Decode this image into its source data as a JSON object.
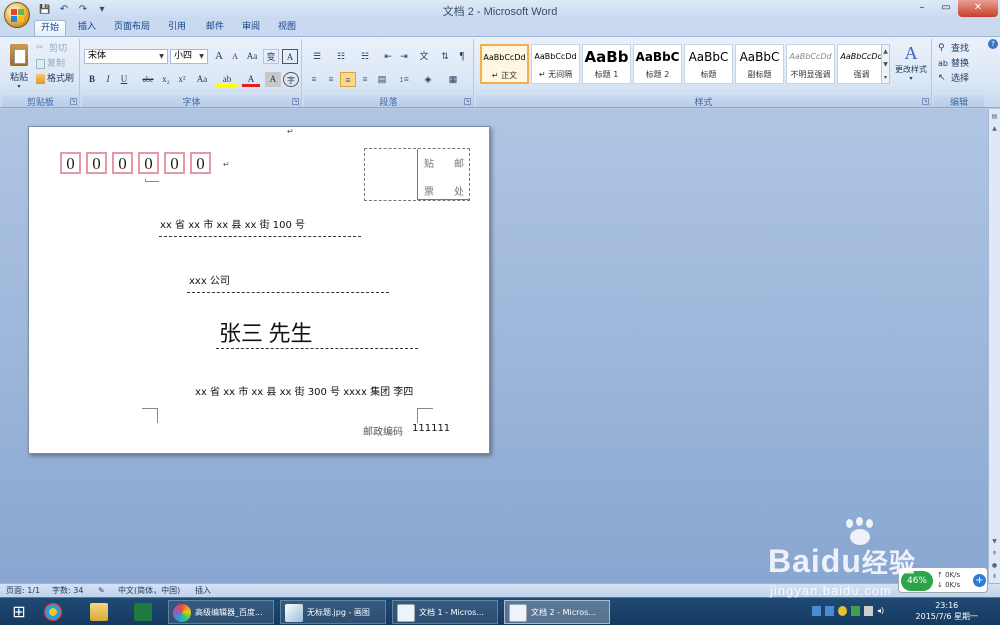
{
  "window": {
    "title": "文档 2 - Microsoft Word",
    "controls": {
      "minimize": "–",
      "maximize": "▭",
      "close": "✕"
    }
  },
  "qat": {
    "save": "💾",
    "undo": "↶",
    "redo": "↷",
    "more": "▾"
  },
  "tabs": [
    {
      "label": "开始",
      "active": true
    },
    {
      "label": "插入"
    },
    {
      "label": "页面布局"
    },
    {
      "label": "引用"
    },
    {
      "label": "邮件"
    },
    {
      "label": "审阅"
    },
    {
      "label": "视图"
    }
  ],
  "ribbon": {
    "clipboard": {
      "group_label": "剪贴板",
      "paste": "粘贴",
      "cut": "剪切",
      "copy": "复制",
      "format_painter": "格式刷"
    },
    "font": {
      "group_label": "字体",
      "font_name": "宋体",
      "font_size": "小四",
      "grow": "A",
      "shrink": "A",
      "clear": "Aa",
      "phonetic": "变",
      "border_char": "A",
      "bold": "B",
      "italic": "I",
      "underline": "U",
      "strike": "abe",
      "subscript": "x₂",
      "superscript": "x²",
      "change_case": "Aa",
      "highlight": "ab",
      "font_color": "A",
      "shade": "A",
      "enclose": "字"
    },
    "paragraph": {
      "group_label": "段落"
    },
    "styles": {
      "group_label": "样式",
      "items": [
        {
          "sample": "AaBbCcDd",
          "name": "↵ 正文",
          "selected": true
        },
        {
          "sample": "AaBbCcDd",
          "name": "↵ 无间隔"
        },
        {
          "sample": "AaBb",
          "name": "标题 1"
        },
        {
          "sample": "AaBbC",
          "name": "标题 2"
        },
        {
          "sample": "AaBbC",
          "name": "标题"
        },
        {
          "sample": "AaBbC",
          "name": "副标题"
        },
        {
          "sample": "AaBbCcDd",
          "name": "不明显强调"
        },
        {
          "sample": "AaBbCcDd",
          "name": "强调"
        }
      ],
      "change_styles": "更改样式"
    },
    "editing": {
      "group_label": "编辑",
      "find": "查找",
      "replace": "替换",
      "select": "选择"
    }
  },
  "document": {
    "postcode_boxes": [
      "0",
      "0",
      "0",
      "0",
      "0",
      "0"
    ],
    "stamp": {
      "tl": "贴",
      "tr": "邮",
      "bl": "票",
      "br": "处"
    },
    "recipient_address": "xx 省 xx 市 xx 县 xx 街 100 号",
    "recipient_company": "xxx 公司",
    "recipient_name": "张三  先生",
    "sender_address": "xx 省 xx 市 xx 县 xx 街 300 号  xxxx 集团  李四",
    "sender_postcode_label": "邮政编码",
    "sender_postcode": "111111",
    "para_mark": "↵"
  },
  "status": {
    "page": "页面: 1/1",
    "words": "字数: 34",
    "language": "中文(简体，中国)",
    "mode": "插入"
  },
  "taskbar": {
    "start": "⊞",
    "items": [
      {
        "label": "高级编辑器_百度..."
      },
      {
        "label": "无标题.jpg - 画图"
      },
      {
        "label": "文档 1 - Micros..."
      },
      {
        "label": "文档 2 - Micros...",
        "active": true
      }
    ],
    "time": "23:16",
    "date": "2015/7/6 星期一"
  },
  "net_widget": {
    "percent": "46%",
    "up": "0K/s",
    "down": "0K/s"
  },
  "watermark": {
    "brand": "Baidu",
    "brand2": "经验",
    "url": "jingyan.baidu.com"
  },
  "colors": {
    "accent": "#15428b",
    "postcode_box": "#e39aa6",
    "style_selected": "#f2b04c"
  }
}
